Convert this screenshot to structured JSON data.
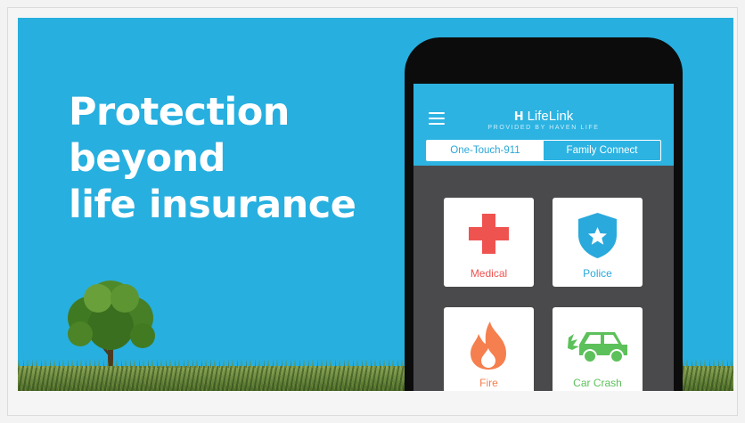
{
  "banner": {
    "headline_lines": [
      "Protection",
      "beyond",
      "life insurance"
    ]
  },
  "app": {
    "brand_name": "LifeLink",
    "brand_logo": "H",
    "brand_sub": "PROVIDED BY HAVEN LIFE",
    "tabs": [
      {
        "label": "One-Touch-911",
        "active": true
      },
      {
        "label": "Family Connect",
        "active": false
      }
    ],
    "services": [
      {
        "label": "Medical",
        "icon": "medical-cross-icon",
        "color": "#ef5350"
      },
      {
        "label": "Police",
        "icon": "police-shield-icon",
        "color": "#29a9dc"
      },
      {
        "label": "Fire",
        "icon": "fire-flame-icon",
        "color": "#f57f4f"
      },
      {
        "label": "Car Crash",
        "icon": "car-crash-icon",
        "color": "#5cc15a"
      }
    ]
  },
  "colors": {
    "banner_background": "#27afdf",
    "app_header": "#2cb3e2",
    "screen_background": "#4a4a4c"
  }
}
